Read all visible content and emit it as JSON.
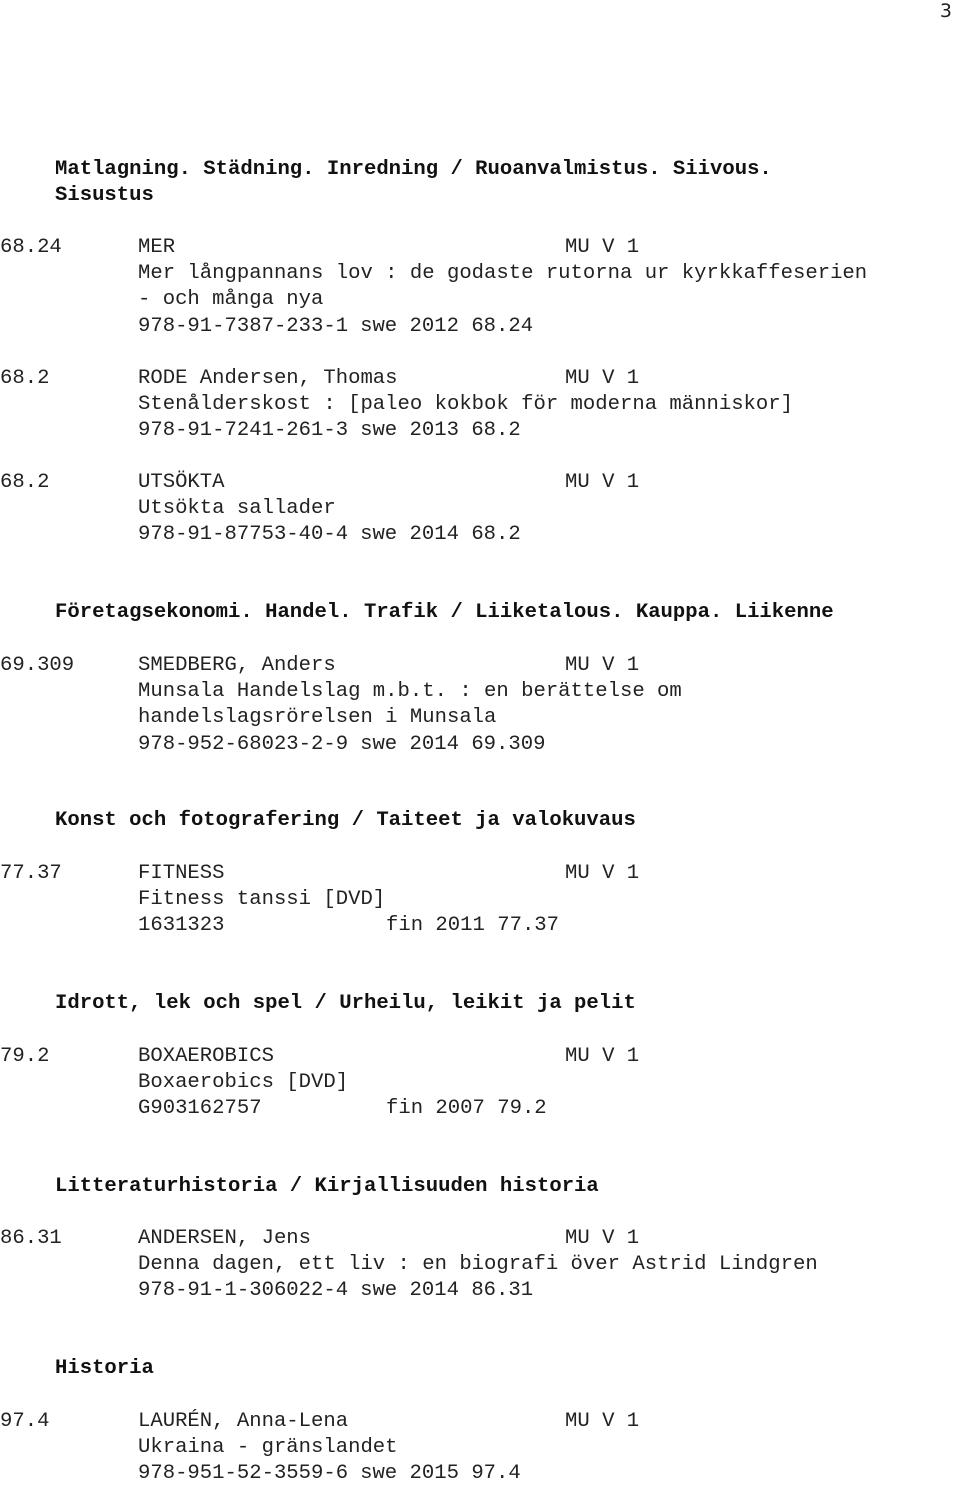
{
  "page_number": "3",
  "sections": [
    {
      "heading": "Matlagning. Städning. Inredning / Ruoanvalmistus. Siivous.\nSisustus",
      "entries": [
        {
          "class": "68.24",
          "main_entry": "MER",
          "location": "MU V 1",
          "title_lines": [
            "Mer långpannans lov : de godaste rutorna ur kyrkkaffeserien",
            "- och många nya"
          ],
          "id": "978-91-7387-233-1",
          "lang_year_class": "swe 2012 68.24"
        },
        {
          "class": "68.2",
          "main_entry": "RODE Andersen, Thomas",
          "location": "MU V 1",
          "title_lines": [
            "Stenålderskost : [paleo kokbok för moderna människor]"
          ],
          "id": "978-91-7241-261-3",
          "lang_year_class": "swe 2013 68.2"
        },
        {
          "class": "68.2",
          "main_entry": "UTSÖKTA",
          "location": "MU V 1",
          "title_lines": [
            "Utsökta sallader"
          ],
          "id": "978-91-87753-40-4",
          "lang_year_class": "swe 2014 68.2"
        }
      ]
    },
    {
      "heading": "Företagsekonomi. Handel. Trafik / Liiketalous. Kauppa. Liikenne",
      "entries": [
        {
          "class": "69.309",
          "main_entry": "SMEDBERG, Anders",
          "location": "MU V 1",
          "title_lines": [
            "Munsala Handelslag m.b.t. : en berättelse om",
            "handelslagsrörelsen i Munsala"
          ],
          "id": "978-952-68023-2-9",
          "lang_year_class": "swe 2014 69.309"
        }
      ]
    },
    {
      "heading": "Konst och fotografering / Taiteet ja valokuvaus",
      "entries": [
        {
          "class": "77.37",
          "main_entry": "FITNESS",
          "location": "MU V 1",
          "title_lines": [
            "Fitness tanssi [DVD]"
          ],
          "id": "1631323",
          "lang_year_class": "fin 2011 77.37"
        }
      ]
    },
    {
      "heading": "Idrott, lek och spel / Urheilu, leikit ja pelit",
      "entries": [
        {
          "class": "79.2",
          "main_entry": "BOXAEROBICS",
          "location": "MU V 1",
          "title_lines": [
            "Boxaerobics [DVD]"
          ],
          "id": "G903162757",
          "lang_year_class": "fin 2007 79.2"
        }
      ]
    },
    {
      "heading": "Litteraturhistoria / Kirjallisuuden historia",
      "entries": [
        {
          "class": "86.31",
          "main_entry": "ANDERSEN, Jens",
          "location": "MU V 1",
          "title_lines": [
            "Denna dagen, ett liv : en biografi över Astrid Lindgren"
          ],
          "id": "978-91-1-306022-4",
          "lang_year_class": "swe 2014 86.31"
        }
      ]
    },
    {
      "heading": "Historia",
      "entries": [
        {
          "class": "97.4",
          "main_entry": "LAURÉN, Anna-Lena",
          "location": "MU V 1",
          "title_lines": [
            "Ukraina - gränslandet"
          ],
          "id": "978-951-52-3559-6",
          "lang_year_class": "swe 2015 97.4"
        }
      ]
    }
  ]
}
